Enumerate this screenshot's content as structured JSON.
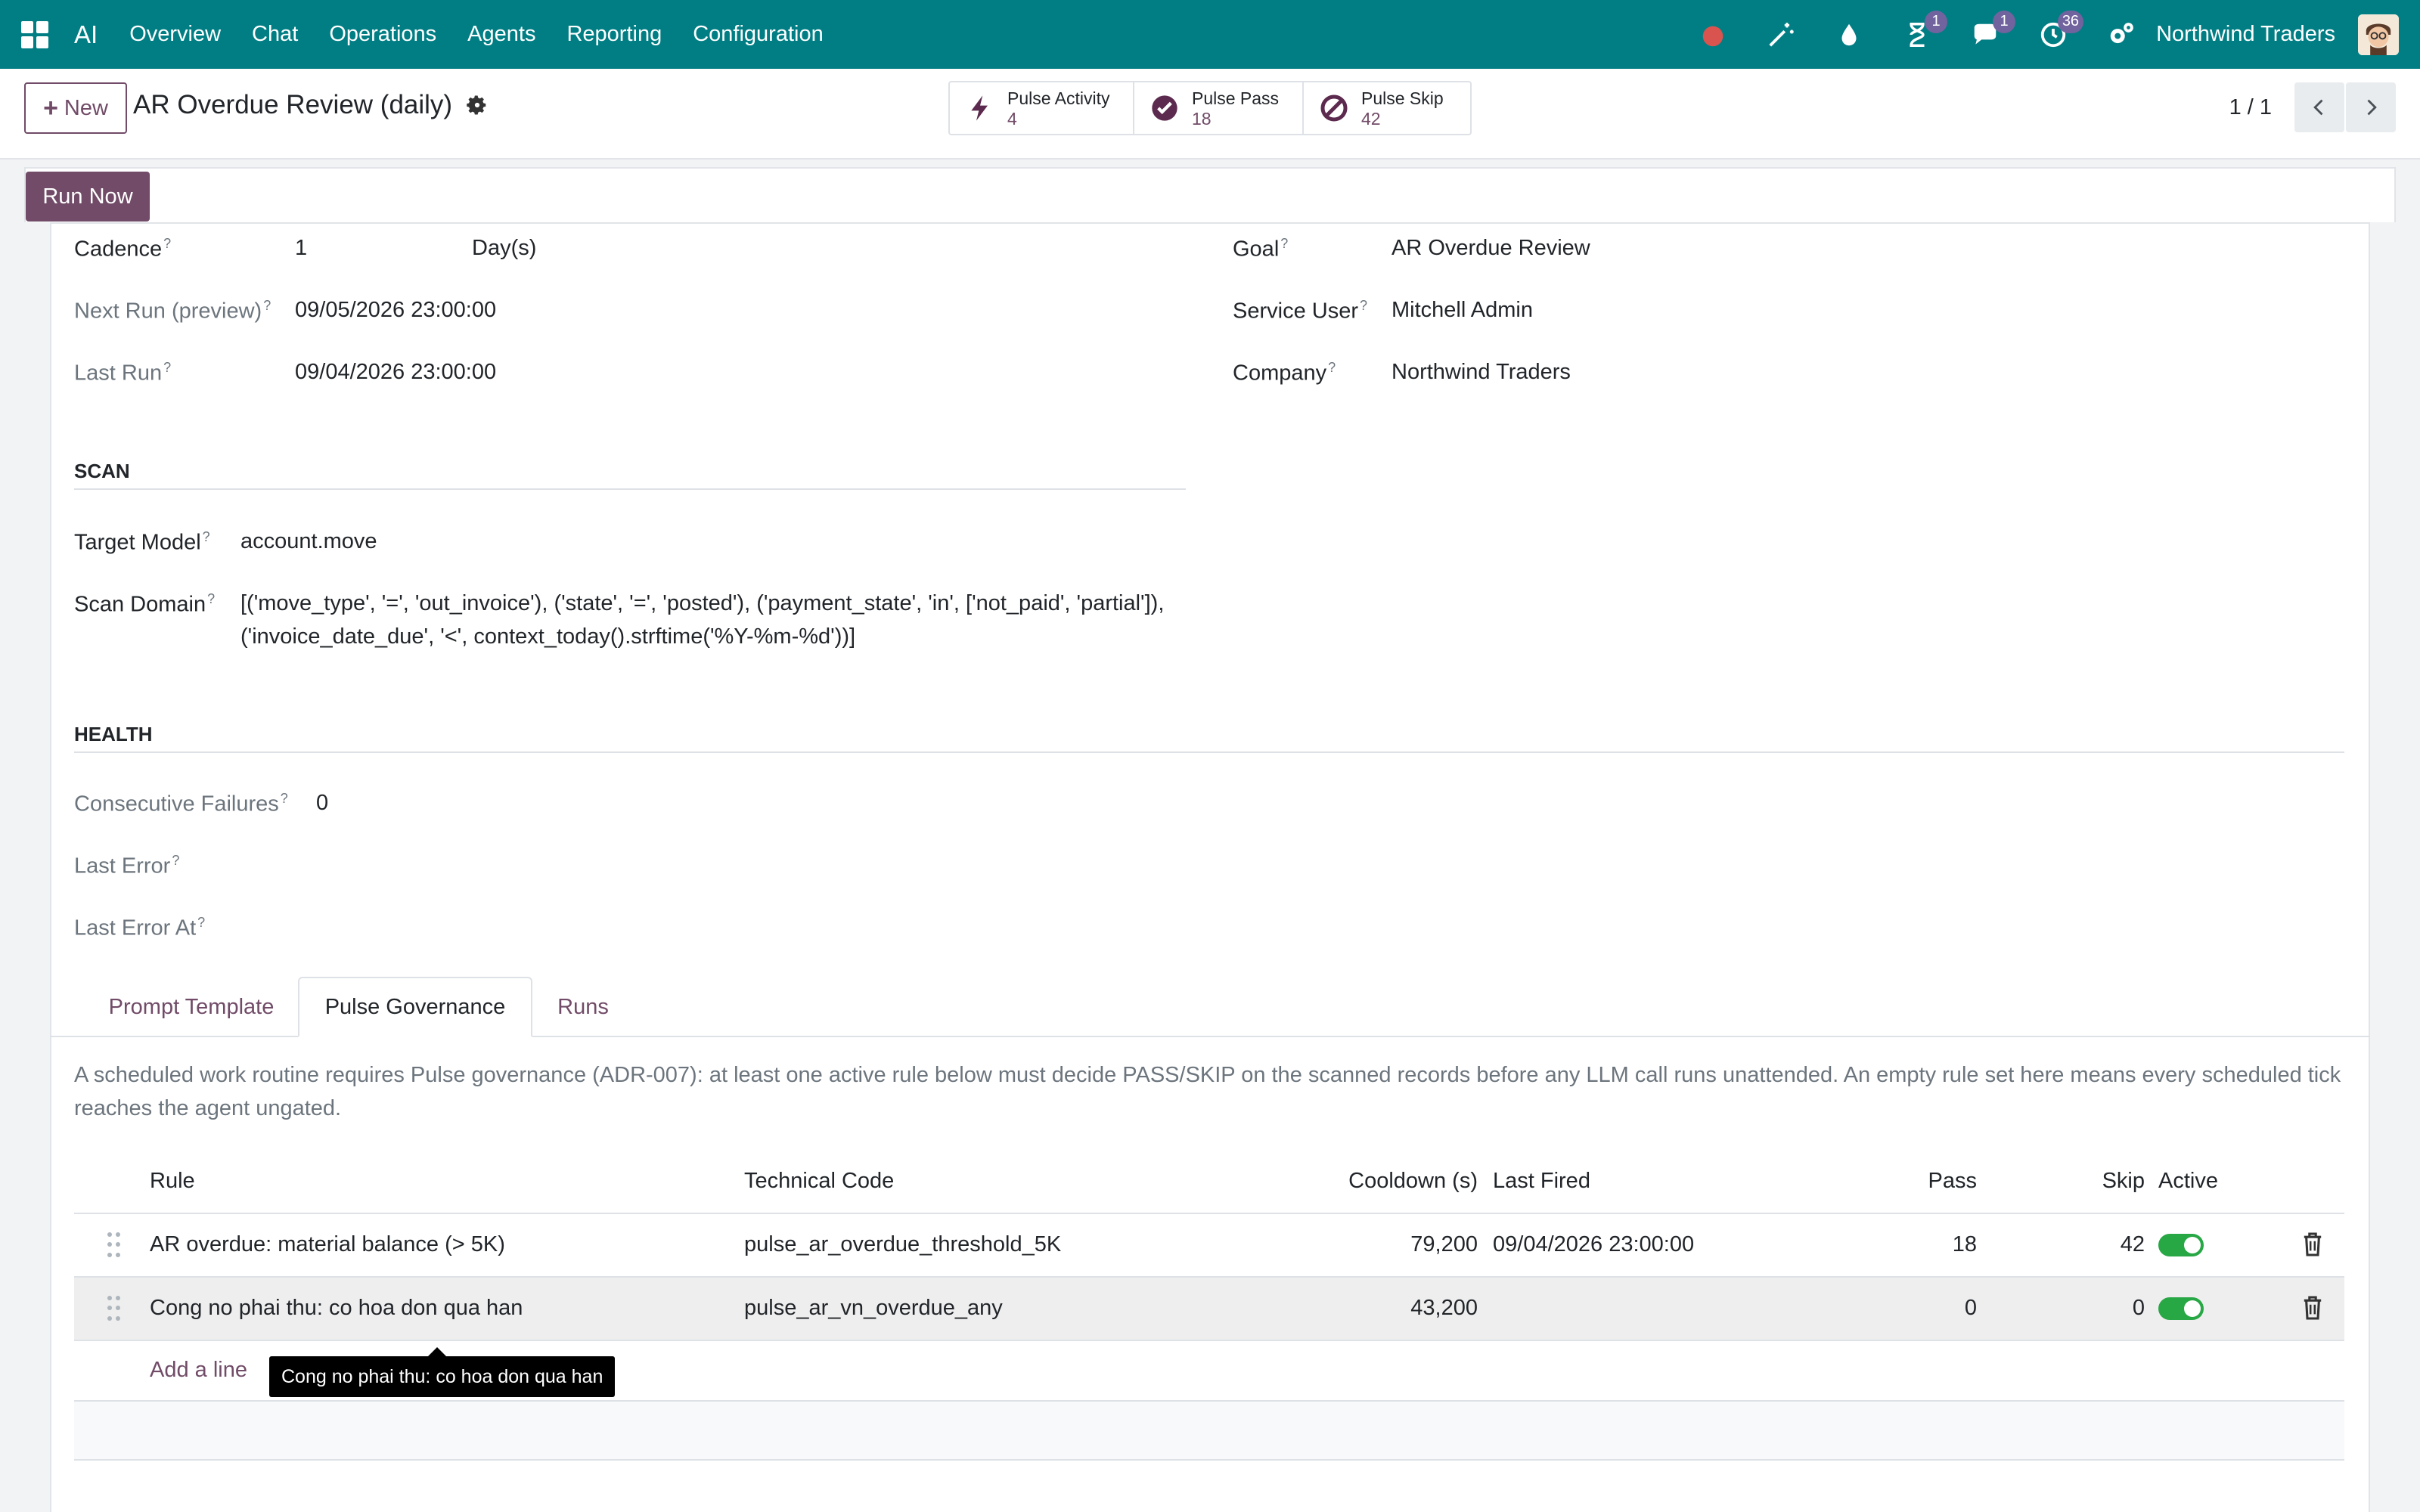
{
  "nav": {
    "app_name": "AI",
    "menu": [
      "Overview",
      "Chat",
      "Operations",
      "Agents",
      "Reporting",
      "Configuration"
    ],
    "company": "Northwind Traders",
    "badges": {
      "activity": "1",
      "messages": "1",
      "clock": "36"
    },
    "icons": [
      "record-dot-icon",
      "magic-wand-icon",
      "drop-icon",
      "hourglass-icon",
      "chat-icon",
      "clock-icon",
      "settings-icon"
    ]
  },
  "control": {
    "new_label": "New",
    "record_title": "AR Overdue Review (daily)",
    "smart_buttons": [
      {
        "label": "Pulse Activity",
        "value": "4",
        "icon": "bolt-icon"
      },
      {
        "label": "Pulse Pass",
        "value": "18",
        "icon": "check-circle-icon"
      },
      {
        "label": "Pulse Skip",
        "value": "42",
        "icon": "ban-icon"
      }
    ],
    "pager": "1 / 1"
  },
  "statusbar": {
    "run_now": "Run Now"
  },
  "form": {
    "cadence_label": "Cadence",
    "cadence_value": "1",
    "cadence_unit": "Day(s)",
    "next_run_label": "Next Run (preview)",
    "next_run_value": "09/05/2026 23:00:00",
    "last_run_label": "Last Run",
    "last_run_value": "09/04/2026 23:00:00",
    "goal_label": "Goal",
    "goal_value": "AR Overdue Review",
    "service_user_label": "Service User",
    "service_user_value": "Mitchell Admin",
    "company_label": "Company",
    "company_value": "Northwind Traders",
    "scan_title": "SCAN",
    "target_model_label": "Target Model",
    "target_model_value": "account.move",
    "scan_domain_label": "Scan Domain",
    "scan_domain_line1": "[('move_type', '=', 'out_invoice'), ('state', '=', 'posted'), ('payment_state', 'in', ['not_paid', 'partial']),",
    "scan_domain_line2": "('invoice_date_due', '<', context_today().strftime('%Y-%m-%d'))]",
    "health_title": "HEALTH",
    "consecutive_failures_label": "Consecutive Failures",
    "consecutive_failures_value": "0",
    "last_error_label": "Last Error",
    "last_error_at_label": "Last Error At",
    "help_marker": "?"
  },
  "tabs": [
    "Prompt Template",
    "Pulse Governance",
    "Runs"
  ],
  "governance": {
    "help_text": "A scheduled work routine requires Pulse governance (ADR-007): at least one active rule below must decide PASS/SKIP on the scanned records before any LLM call runs unattended. An empty rule set here means every scheduled tick reaches the agent ungated.",
    "columns": [
      "Rule",
      "Technical Code",
      "Cooldown (s)",
      "Last Fired",
      "Pass",
      "Skip",
      "Active"
    ],
    "rows": [
      {
        "rule": "AR overdue: material balance (> 5K)",
        "code": "pulse_ar_overdue_threshold_5K",
        "cooldown": "79,200",
        "last_fired": "09/04/2026 23:00:00",
        "pass": "18",
        "skip": "42",
        "active": true
      },
      {
        "rule": "Cong no phai thu: co hoa don qua han",
        "code": "pulse_ar_vn_overdue_any",
        "cooldown": "43,200",
        "last_fired": "",
        "pass": "0",
        "skip": "0",
        "active": true
      }
    ],
    "add_line": "Add a line",
    "tooltip": "Cong no phai thu: co hoa don qua han"
  }
}
